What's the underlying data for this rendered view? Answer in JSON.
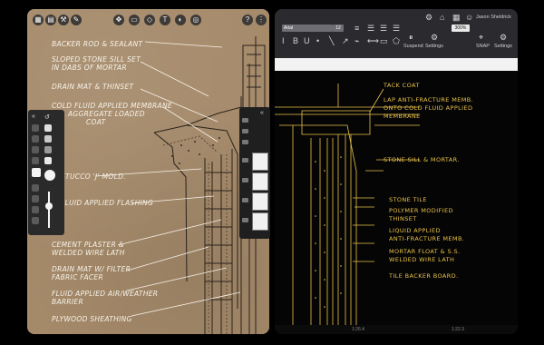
{
  "left": {
    "notes": [
      "Backer Rod & Sealant",
      "Sloped Stone Sill Set",
      "in Dabs of Mortar",
      "Drain Mat & Thinset",
      "Cold Fluid Applied Membrane",
      "Aggregate Loaded",
      "Coat",
      "Stucco 'J' Mold.",
      "Fluid Applied Flashing",
      "Cement Plaster &",
      "Welded Wire Lath",
      "Drain Mat w/ Filter",
      "Fabric Facer",
      "Fluid Applied Air/Weather",
      "Barrier",
      "Plywood Sheathing"
    ]
  },
  "right": {
    "font_name": "Arial",
    "font_size": "12",
    "zoom": "300%",
    "user_name": "Jason Sheldrick",
    "toolbar": {
      "suspend": "Suspend",
      "settings1": "Settings",
      "snap": "SNAP",
      "settings2": "Settings"
    },
    "notes": [
      "Tack Coat",
      "Lap Anti-Fracture Memb.",
      "onto Cold Fluid Applied",
      "Membrane",
      "Stone Sill & Mortar.",
      "Stone Tile",
      "Polymer Modified",
      "Thinset",
      "Liquid Applied",
      "Anti-Fracture Memb.",
      "Mortar Float & S.S.",
      "Welded Wire Lath",
      "Tile Backer Board."
    ],
    "status": {
      "left_coord": "1:26.4",
      "right_coord": "1:22.3"
    }
  },
  "colors": {
    "kraft": "#a58a6a",
    "cad_yellow": "#e9c24a",
    "toolbar": "#2b2b2f"
  }
}
